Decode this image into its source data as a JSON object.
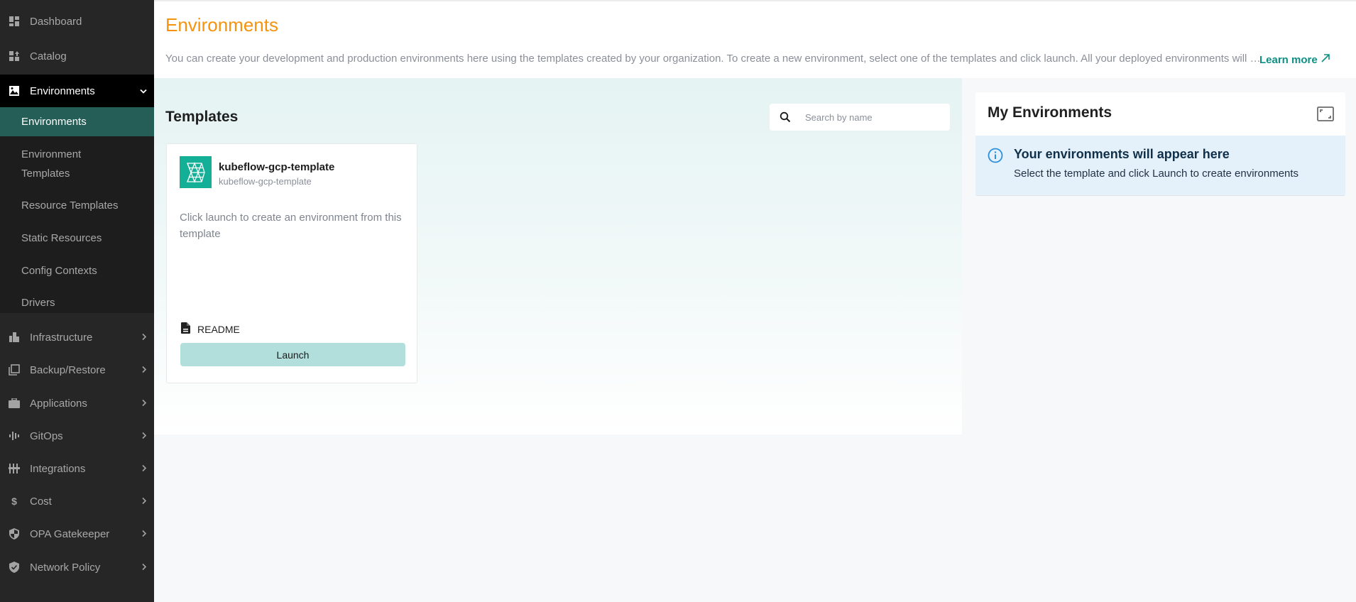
{
  "sidebar": {
    "top_items": [
      {
        "label": "Dashboard",
        "icon": "dashboard-icon"
      },
      {
        "label": "Catalog",
        "icon": "catalog-icon"
      }
    ],
    "open_section": {
      "label": "Environments",
      "icon": "image-icon",
      "expanded": true,
      "children": [
        {
          "label": "Environments",
          "active": true
        },
        {
          "label": "Environment Templates"
        },
        {
          "label": "Resource Templates"
        },
        {
          "label": "Static Resources"
        },
        {
          "label": "Config Contexts"
        },
        {
          "label": "Drivers"
        }
      ]
    },
    "collapsed_sections": [
      {
        "label": "Infrastructure",
        "icon": "building-icon"
      },
      {
        "label": "Backup/Restore",
        "icon": "copy-icon"
      },
      {
        "label": "Applications",
        "icon": "briefcase-icon"
      },
      {
        "label": "GitOps",
        "icon": "waveform-icon"
      },
      {
        "label": "Integrations",
        "icon": "integrations-icon"
      },
      {
        "label": "Cost",
        "icon": "dollar-icon"
      },
      {
        "label": "OPA Gatekeeper",
        "icon": "shield-half-icon"
      },
      {
        "label": "Network Policy",
        "icon": "shield-check-icon"
      }
    ]
  },
  "header": {
    "title": "Environments",
    "description": "You can create your development and production environments here using the templates created by your organization. To create a new environment, select one of the templates and click launch. All your deployed environments will appear in My Environments.",
    "learn_more_label": "Learn more",
    "title_color": "#f5930f",
    "link_color": "#0e8f84"
  },
  "templates": {
    "title": "Templates",
    "search": {
      "placeholder": "Search by name",
      "value": ""
    },
    "items": [
      {
        "name": "kubeflow-gcp-template",
        "subtitle": "kubeflow-gcp-template",
        "description": "Click launch to create an environment from this template",
        "readme_label": "README",
        "launch_label": "Launch",
        "logo_color": "#13af96"
      }
    ]
  },
  "my_environments": {
    "title": "My Environments",
    "empty_title": "Your environments will appear here",
    "empty_text": "Select the template and click Launch to create environments"
  }
}
